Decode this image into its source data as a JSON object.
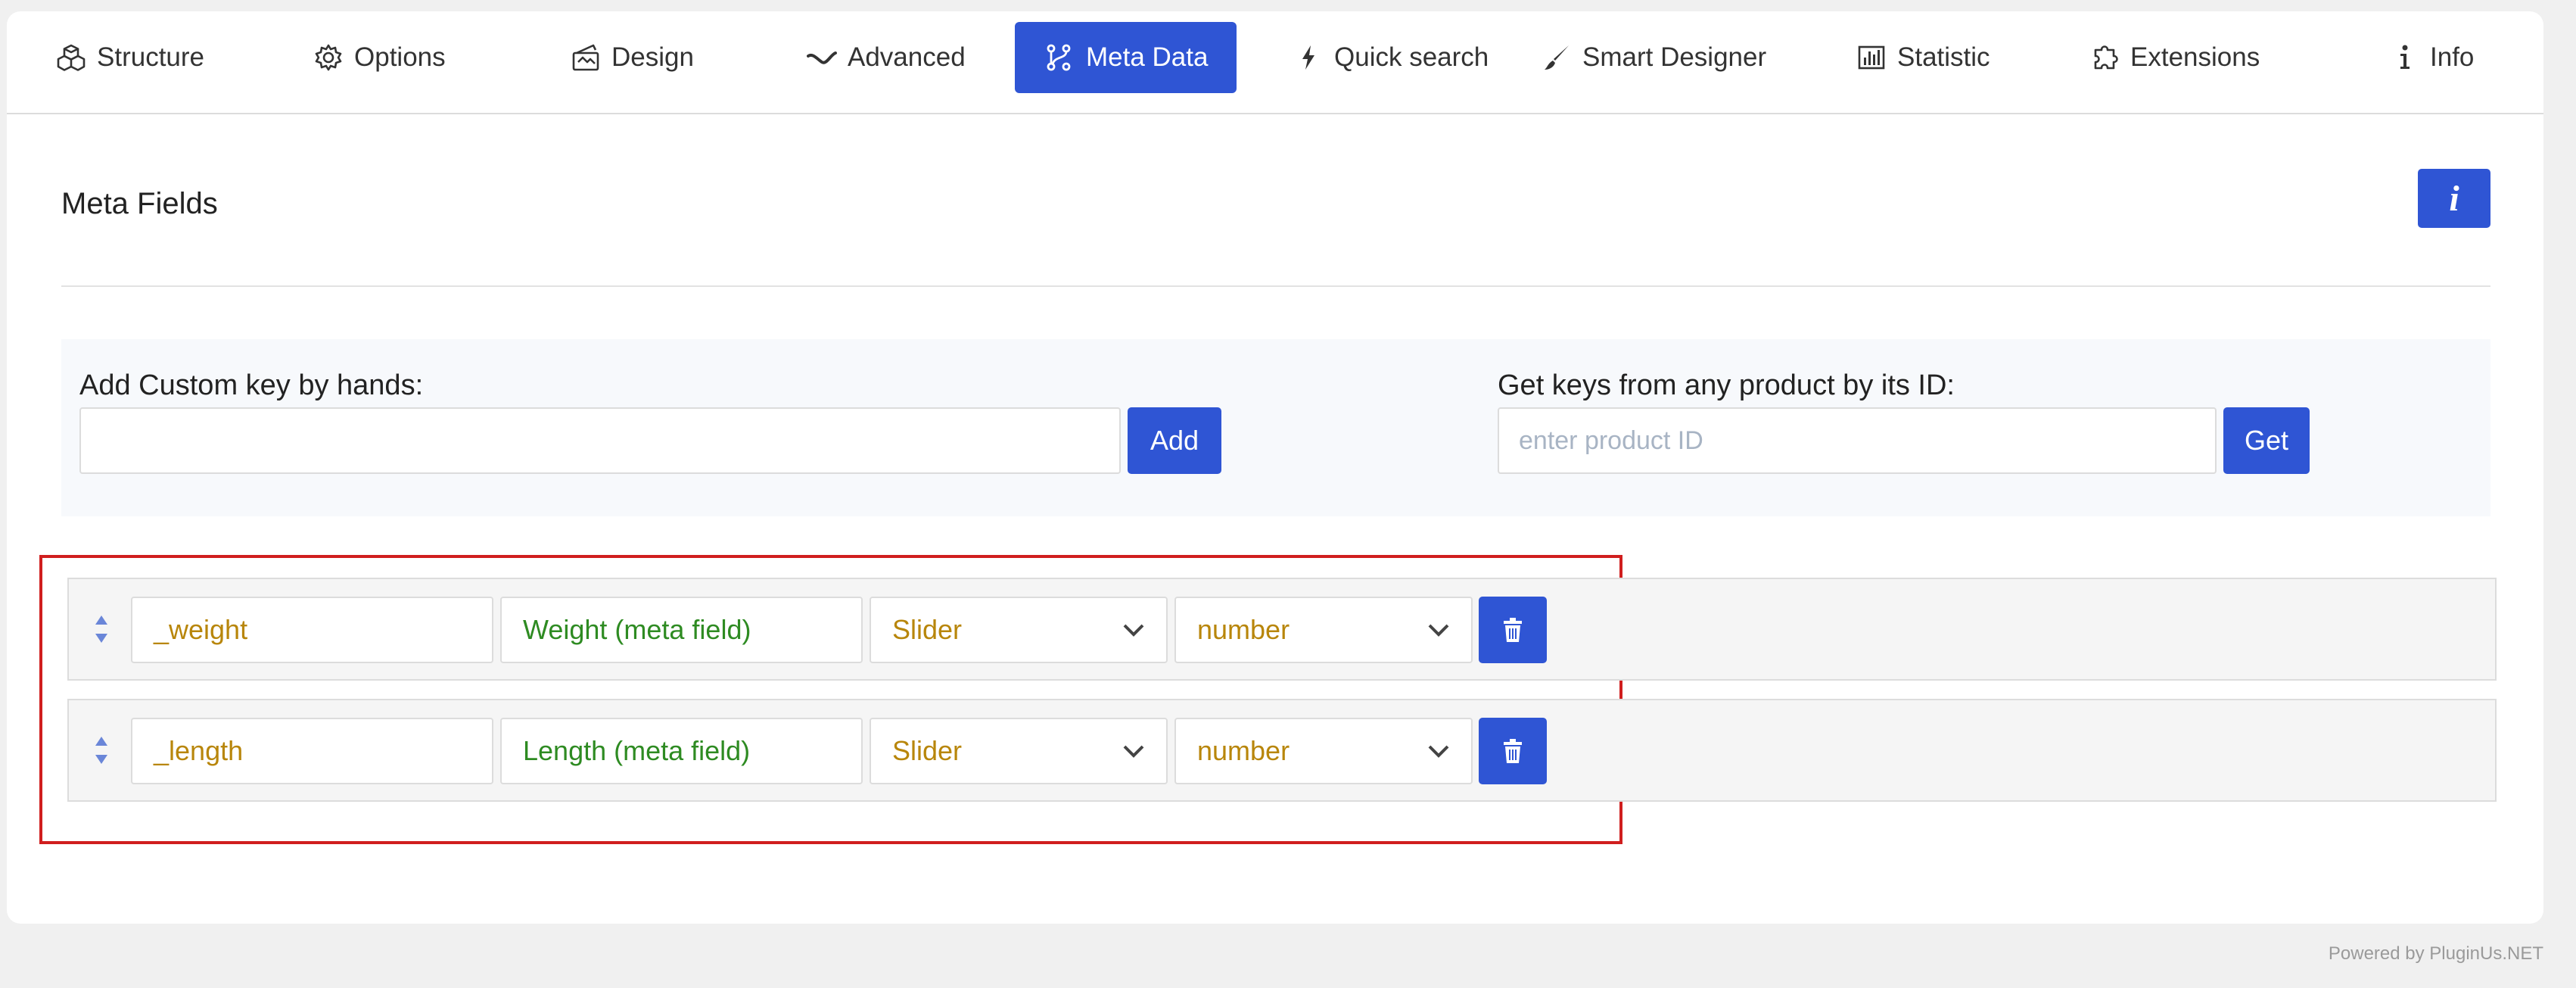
{
  "tabs": [
    {
      "label": "Structure",
      "icon": "cubes-icon"
    },
    {
      "label": "Options",
      "icon": "gear-icon"
    },
    {
      "label": "Design",
      "icon": "design-icon"
    },
    {
      "label": "Advanced",
      "icon": "wave-icon"
    },
    {
      "label": "Meta Data",
      "icon": "network-icon",
      "active": true
    },
    {
      "label": "Quick search",
      "icon": "bolt-icon"
    },
    {
      "label": "Smart Designer",
      "icon": "brush-icon"
    },
    {
      "label": "Statistic",
      "icon": "bar-chart-icon"
    },
    {
      "label": "Extensions",
      "icon": "puzzle-icon"
    },
    {
      "label": "Info",
      "icon": "info-icon"
    }
  ],
  "section": {
    "title": "Meta Fields",
    "info_button_glyph": "i"
  },
  "custom_key": {
    "label": "Add Custom key by hands:",
    "value": "",
    "placeholder": "",
    "button": "Add"
  },
  "product_keys": {
    "label": "Get keys from any product by its ID:",
    "value": "",
    "placeholder": "enter product ID",
    "button": "Get"
  },
  "meta_rows": [
    {
      "key": "_weight",
      "title": "Weight (meta field)",
      "view": "Slider",
      "type": "number"
    },
    {
      "key": "_length",
      "title": "Length (meta field)",
      "view": "Slider",
      "type": "number"
    }
  ],
  "footer": {
    "powered_by": "Powered by PluginUs.NET"
  },
  "colors": {
    "accent": "#2f55d4",
    "highlight": "#d01e1e",
    "key_text": "#b8860b",
    "title_text": "#2e8b22"
  }
}
